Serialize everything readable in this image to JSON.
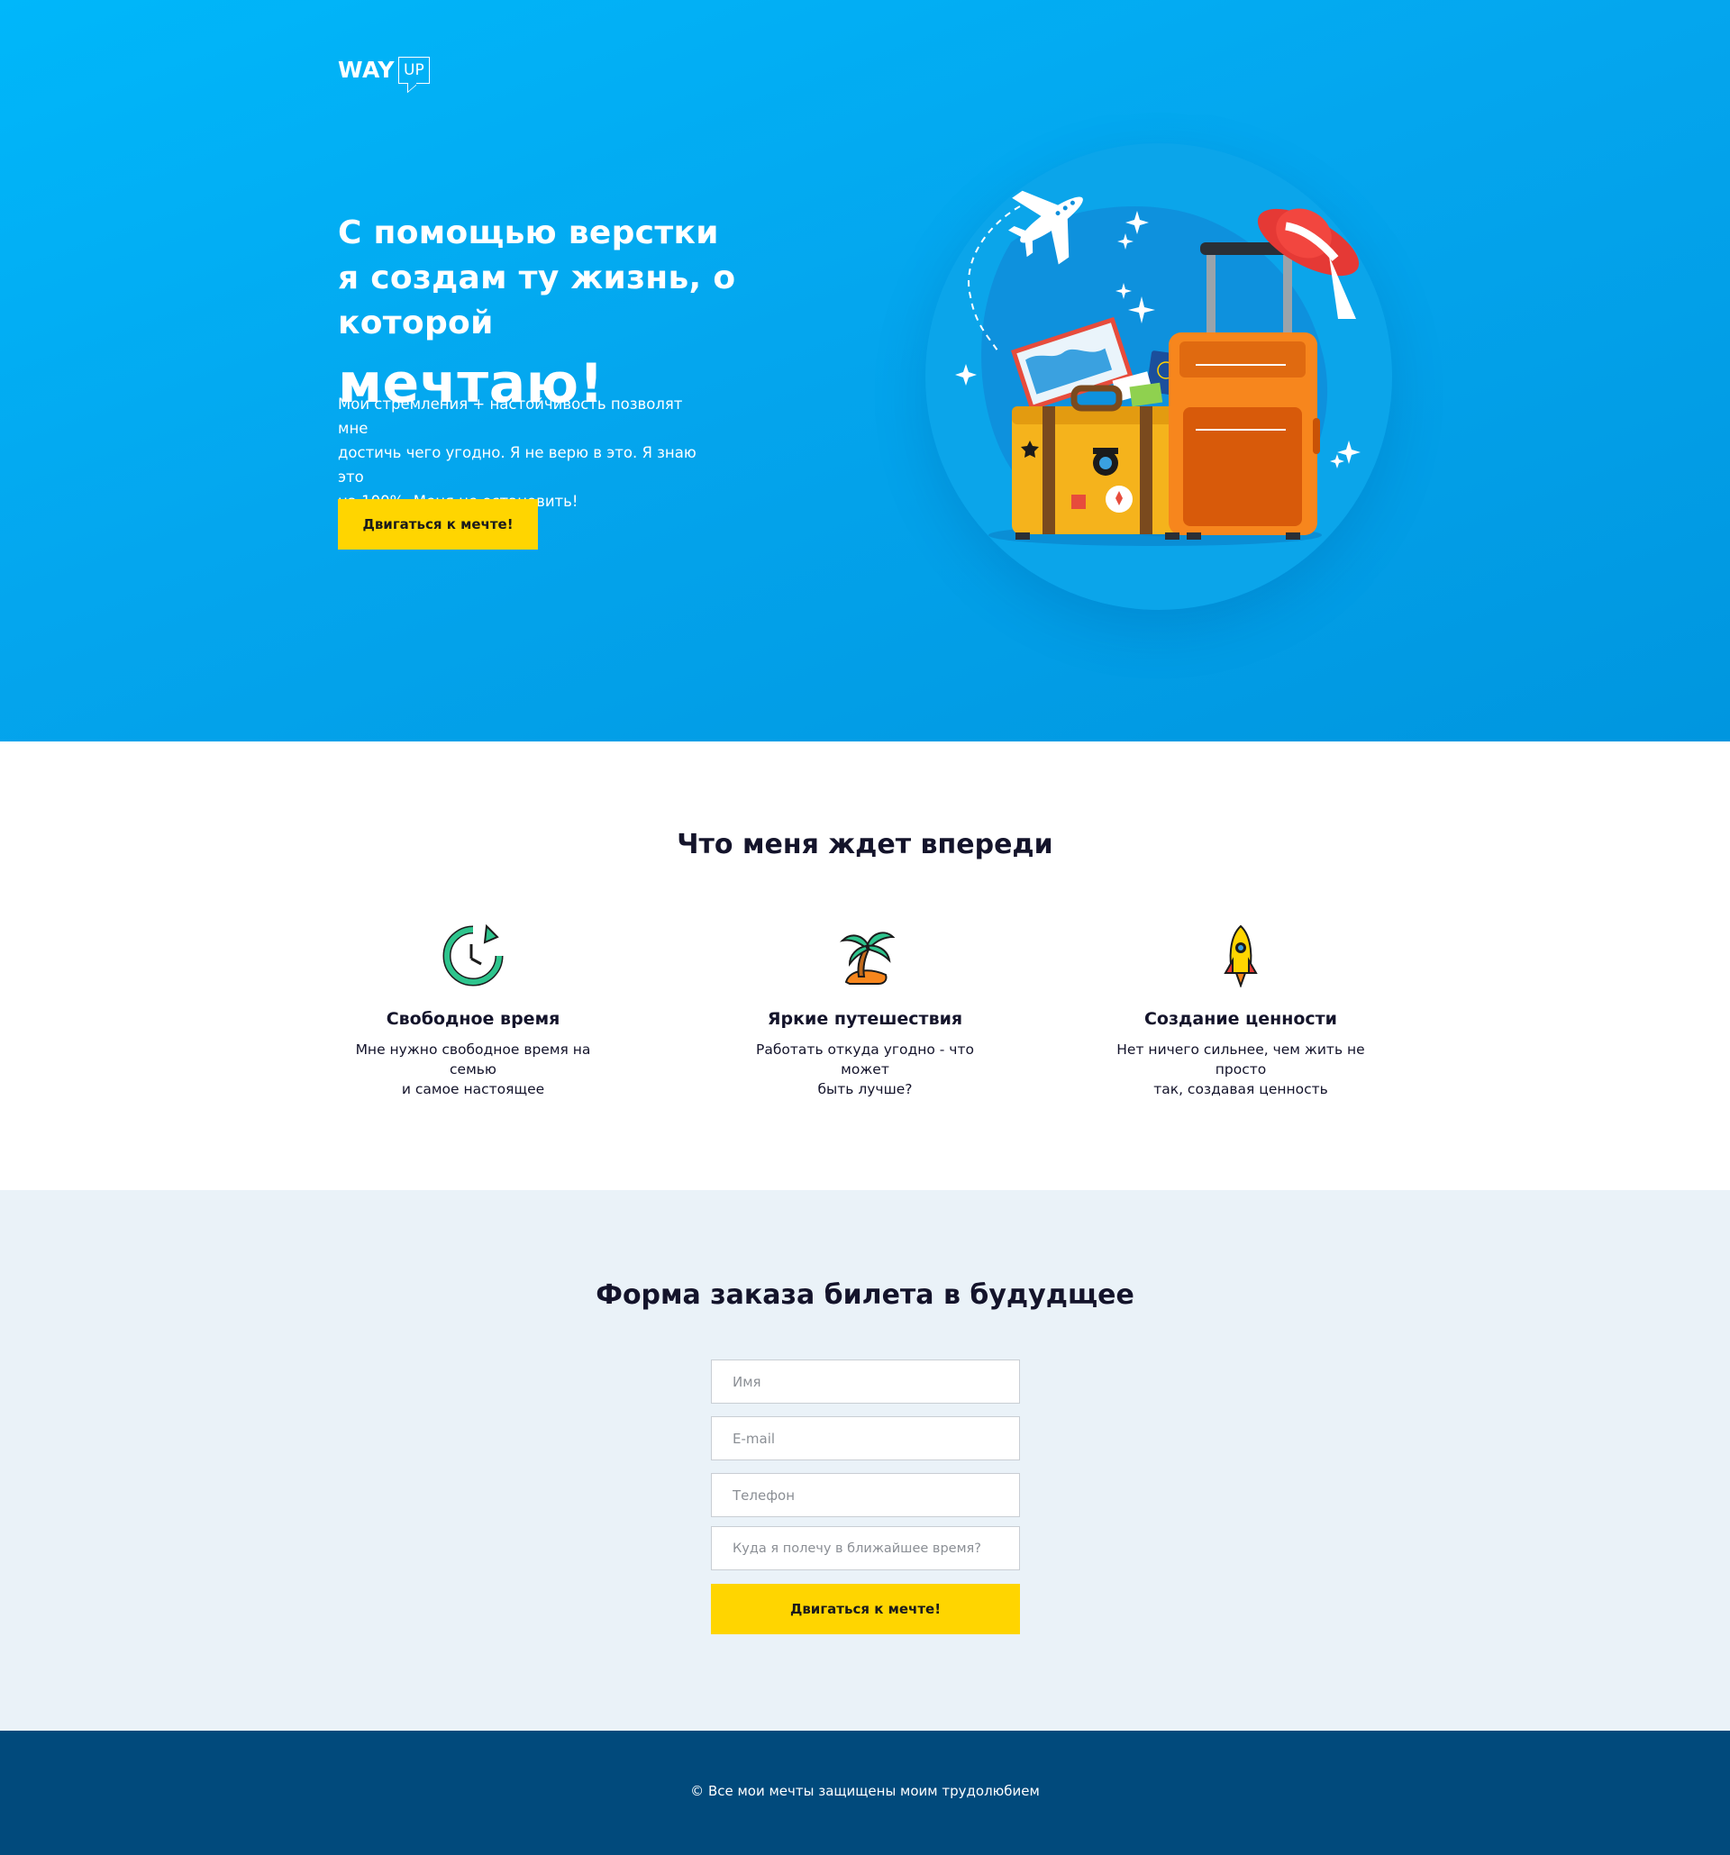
{
  "header": {
    "logo_word": "WAY",
    "logo_tag": "UP"
  },
  "hero": {
    "title_line1": "С помощью верстки",
    "title_line2": "я создам ту жизнь, о которой",
    "title_accent": "мечтаю!",
    "text_line1": "Мои стремления + настойчивость позволят мне",
    "text_line2": "достичь чего угодно. Я не верю в это. Я знаю это",
    "text_line3": "на 100%. Меня не остановить!",
    "button_label": "Двигаться к мечте!",
    "illustration_icon": "travel-suitcases-icon"
  },
  "features": {
    "title": "Что меня ждет впереди",
    "items": [
      {
        "icon": "clock-refresh-icon",
        "title": "Свободное время",
        "text_line1": "Мне нужно свободное время на семью",
        "text_line2": "и самое настоящее"
      },
      {
        "icon": "palm-island-icon",
        "title": "Яркие путешествия",
        "text_line1": "Работать откуда угодно - что может",
        "text_line2": "быть лучше?"
      },
      {
        "icon": "rocket-icon",
        "title": "Создание ценности",
        "text_line1": "Нет ничего сильнее, чем жить не просто",
        "text_line2": "так, создавая ценность"
      }
    ]
  },
  "order_form": {
    "title": "Форма заказа билета в будудщее",
    "name_placeholder": "Имя",
    "email_placeholder": "E-mail",
    "phone_placeholder": "Телефон",
    "destination_placeholder": "Куда я полечу в ближайшее время?",
    "button_label": "Двигаться к мечте!"
  },
  "footer": {
    "copyright": "© Все мои мечты защищены моим трудолюбием"
  },
  "colors": {
    "hero_bg": "#04a6ee",
    "accent_yellow": "#ffd500",
    "form_bg": "#eaf2f8",
    "footer_bg": "#014a7c",
    "heading": "#14142b"
  }
}
